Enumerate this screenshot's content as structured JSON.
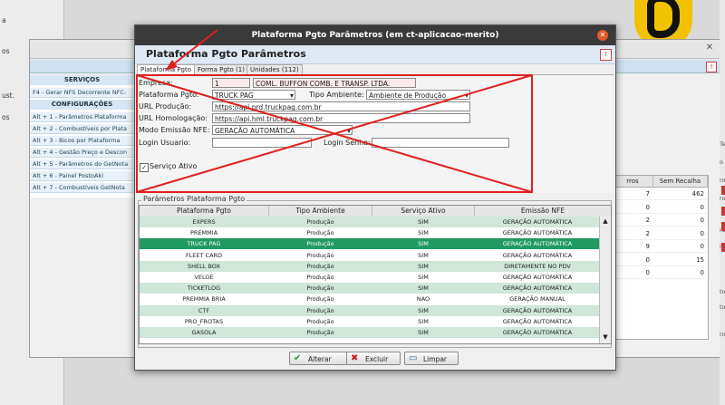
{
  "background": {
    "left_items": [
      "a",
      "os",
      "ust.",
      "os"
    ],
    "sidebar": {
      "sections": [
        {
          "title": "SERVIÇOS",
          "items": [
            "F4 - Gerar NFS Decorrente NFC-"
          ]
        },
        {
          "title": "CONFIGURAÇÕES",
          "items": [
            "Alt + 1 - Parâmetros Plataforma",
            "Alt + 2 - Combustíveis por Plata",
            "Alt + 3 - Bicos por Plataforma",
            "Alt + 4 - Gestão Preço e Descon",
            "Alt + 5 - Parâmetros do GetNota",
            "Alt + 6 - Painel PostoAki",
            "Alt + 7 - Combustíveis GetNota"
          ]
        }
      ]
    },
    "right_table": {
      "headers": [
        "rros",
        "Sem Recalha"
      ],
      "rows": [
        [
          "7",
          "462"
        ],
        [
          "0",
          "0"
        ],
        [
          "2",
          "0"
        ],
        [
          "2",
          "0"
        ],
        [
          "9",
          "0"
        ],
        [
          "0",
          "15"
        ],
        [
          "0",
          "0"
        ]
      ]
    },
    "edge_texts": [
      "Te",
      "o",
      "ro",
      "ro",
      "ro",
      "io",
      "tol",
      "tol",
      "ro"
    ]
  },
  "dialog": {
    "title": "Plataforma Pgto Parâmetros (em ct-aplicacao-merito)",
    "header_title": "Plataforma Pgto Parâmetros",
    "tabs": [
      "Plataforma Pgto",
      "Forma Pgto (1)",
      "Unidades (112)"
    ],
    "form": {
      "empresa_label": "Empresa:",
      "empresa_code": "1",
      "empresa_name": "COML. BUFFON COMB. E TRANSP. LTDA.",
      "plataforma_label": "Plataforma Pgto:",
      "plataforma_value": "TRUCK PAG",
      "tipo_ambiente_label": "Tipo Ambiente:",
      "tipo_ambiente_value": "Ambiente de Produção",
      "url_producao_label": "URL Produção:",
      "url_producao_value": "https://api.prd.truckpag.com.br",
      "url_homologacao_label": "URL Homologação:",
      "url_homologacao_value": "https://api.hml.truckpag.com.br",
      "modo_emissao_label": "Modo Emissão NFE:",
      "modo_emissao_value": "GERAÇÃO AUTOMÁTICA",
      "login_usuario_label": "Login Usuario:",
      "login_usuario_value": "",
      "login_senha_label": "Login Senha:",
      "login_senha_value": "",
      "servico_ativo_label": "Serviço Ativo",
      "servico_ativo_checked": true
    },
    "group_title": "Parâmetros Plataforma Pgto",
    "grid": {
      "headers": [
        "Plataforma Pgto",
        "Tipo Ambiente",
        "Serviço Ativo",
        "Emissão NFE"
      ],
      "rows": [
        [
          "EXPERS",
          "Produção",
          "SIM",
          "GERAÇÃO AUTOMÁTICA"
        ],
        [
          "PREMMIA",
          "Produção",
          "SIM",
          "GERAÇÃO AUTOMÁTICA"
        ],
        [
          "TRUCK PAG",
          "Produção",
          "SIM",
          "GERAÇÃO AUTOMÁTICA"
        ],
        [
          "FLEET CARD",
          "Produção",
          "SIM",
          "GERAÇÃO AUTOMÁTICA"
        ],
        [
          "SHELL BOX",
          "Produção",
          "SIM",
          "DIRETAMENTE NO PDV"
        ],
        [
          "VELOE",
          "Produção",
          "SIM",
          "GERAÇÃO AUTOMÁTICA"
        ],
        [
          "TICKETLOG",
          "Produção",
          "SIM",
          "GERAÇÃO AUTOMÁTICA"
        ],
        [
          "PREMMIA BRIA",
          "Produção",
          "NAO",
          "GERAÇÃO MANUAL"
        ],
        [
          "CTF",
          "Produção",
          "SIM",
          "GERAÇÃO AUTOMÁTICA"
        ],
        [
          "PRO_FROTAS",
          "Produção",
          "SIM",
          "GERAÇÃO AUTOMÁTICA"
        ],
        [
          "GASOLA",
          "Produção",
          "SIM",
          "GERAÇÃO AUTOMÁTICA"
        ]
      ],
      "selected_index": 2
    },
    "buttons": {
      "alterar": "Alterar",
      "excluir": "Excluir",
      "limpar": "Limpar"
    }
  },
  "colors": {
    "selected_row": "#1f9a63",
    "row_even": "#cfe6d9",
    "row_odd": "#ffffff",
    "annotation_red": "#e02020"
  }
}
